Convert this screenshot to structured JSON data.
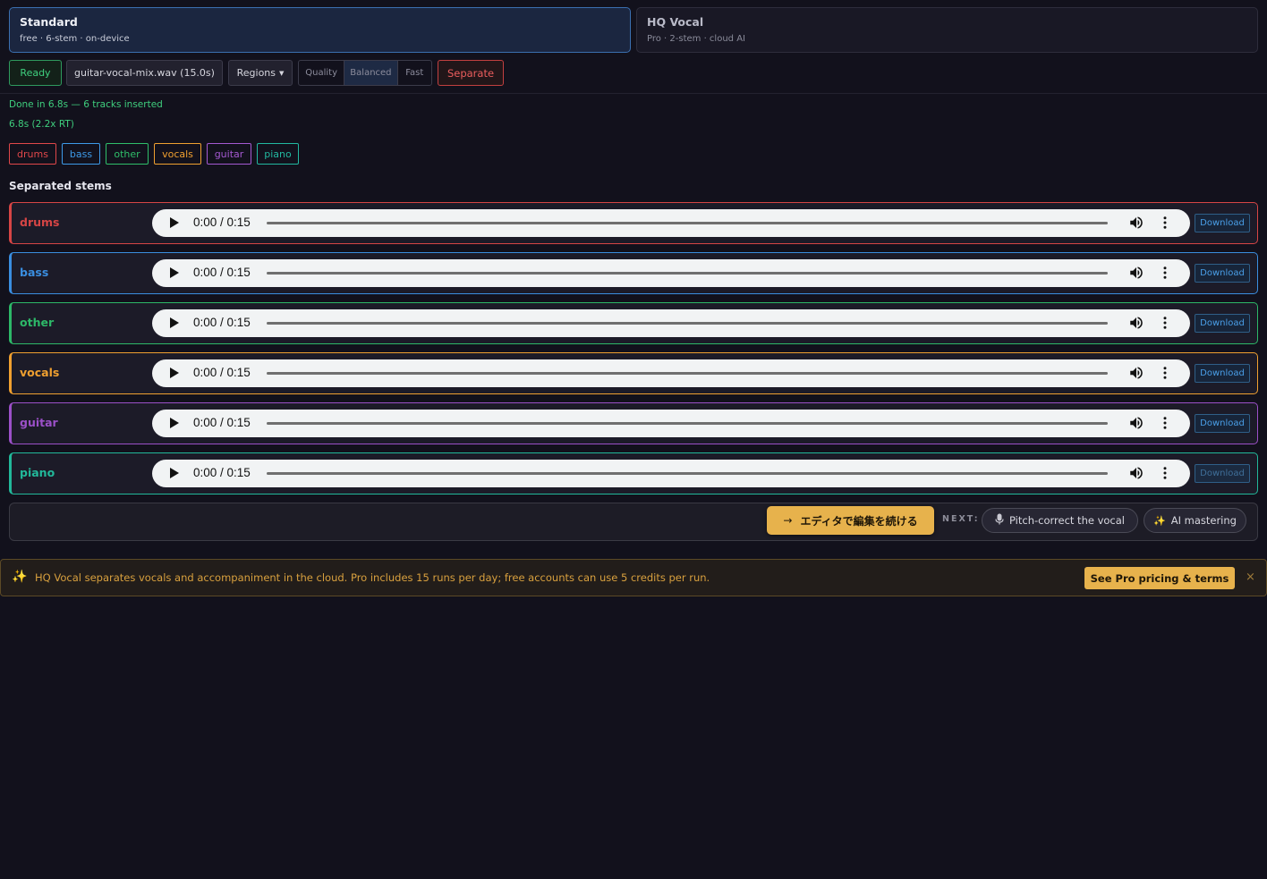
{
  "modes": {
    "standard": {
      "title": "Standard",
      "subtitle": "free · 6-stem · on-device"
    },
    "hq": {
      "title": "HQ Vocal",
      "subtitle": "Pro · 2-stem · cloud AI"
    }
  },
  "toolbar": {
    "status": "Ready",
    "file": "guitar-vocal-mix.wav (15.0s)",
    "regions": "Regions",
    "quality_options": [
      "Quality",
      "Balanced",
      "Fast"
    ],
    "quality_selected": "Balanced",
    "separate": "Separate"
  },
  "status": {
    "done": "Done in 6.8s — 6 tracks inserted",
    "rt": "6.8s (2.2x RT)"
  },
  "chips": [
    {
      "label": "drums",
      "color": "#e0474a"
    },
    {
      "label": "bass",
      "color": "#3d9ae8"
    },
    {
      "label": "other",
      "color": "#2fbf6a"
    },
    {
      "label": "vocals",
      "color": "#f0a030"
    },
    {
      "label": "guitar",
      "color": "#a459d1"
    },
    {
      "label": "piano",
      "color": "#22b8a0"
    }
  ],
  "stems_heading": "Separated stems",
  "stems": [
    {
      "name": "drums",
      "time": "0:00 / 0:15",
      "download": "Download",
      "color": "#d64545"
    },
    {
      "name": "bass",
      "time": "0:00 / 0:15",
      "download": "Download",
      "color": "#3a8ee0"
    },
    {
      "name": "other",
      "time": "0:00 / 0:15",
      "download": "Download",
      "color": "#2db868"
    },
    {
      "name": "vocals",
      "time": "0:00 / 0:15",
      "download": "Download",
      "color": "#f0a030"
    },
    {
      "name": "guitar",
      "time": "0:00 / 0:15",
      "download": "Download",
      "color": "#9b50c8"
    },
    {
      "name": "piano",
      "time": "0:00 / 0:15",
      "download": "Download",
      "color": "#22b89a"
    }
  ],
  "next": {
    "editor_button": "エディタで編集を続ける",
    "label": "NEXT:",
    "pitch": "Pitch-correct the vocal",
    "mastering": "AI mastering"
  },
  "banner": {
    "text": "HQ Vocal separates vocals and accompaniment in the cloud. Pro includes 15 runs per day; free accounts can use 5 credits per run.",
    "button": "See Pro pricing & terms",
    "close": "×"
  }
}
